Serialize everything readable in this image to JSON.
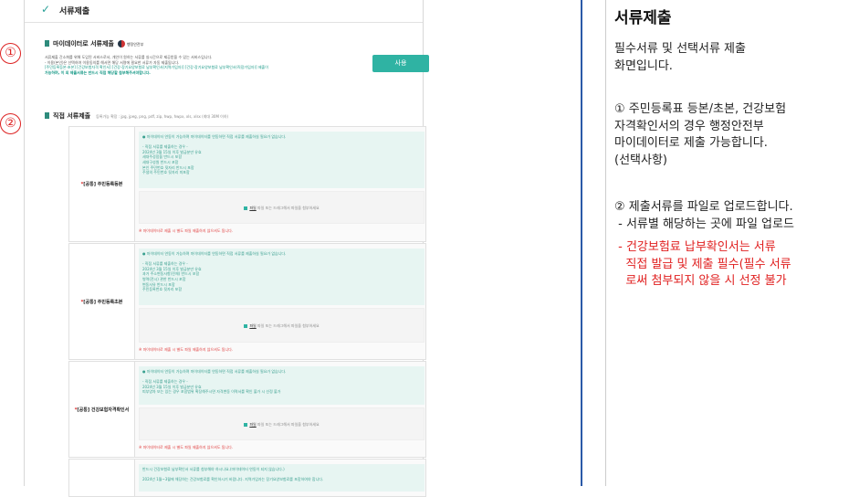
{
  "header": {
    "check_icon": "✓",
    "title": "서류제출"
  },
  "mydata": {
    "marker": "①",
    "title": "마이데이터로 서류제출",
    "gov_label": "행정안전부",
    "desc_lines": [
      "서류제출 간소화를 위해 도입된 서비스로서, 개인이 원하는 서류를 실시간으로 제공받을 수 있는 서비스입니다.",
      "- 이용(본인)은 선택하여 이용동의를 해서면 해당 서명에 필요한 서류가 자동 제출됩니다."
    ],
    "teal_line": "[주민등록등본·초본] [건강보험자격 확인서] [건강·장기요양보험료 납부확인서(지역가입자)] [건강·장기요양보험료 납부확인서(직장가입자)] 제출이",
    "note_line": "가능하며, 이 외 제출서류는 반드시 직접 해당할 첨부해주셔야합니다.",
    "button": "사용"
  },
  "direct": {
    "marker": "②",
    "title": "직접 서류제출",
    "hint": "등록가능 확장 : jpg, jpeg, png, pdf, zip, hwp, hwpx, xls, xlsx (최대 30M 이하)"
  },
  "docs": [
    {
      "req": "*",
      "label": "[공통] 주민등록등본",
      "info": [
        "● 마이데이터 연동이 가능하며 마이데이터를 연동하면 직접 서류를 제출하실 필요가 없습니다.",
        "",
        "- 직접 서류를 제출하는 경우 -",
        "2024년 3월 15일 이후 발급분만 유효",
        "세대주성함을 반드시 포함",
        "세대구성원 반드시 포함",
        "본인 주민번호 뒷자리 반드시 포함",
        "주생의 주민번호 뒷자리 미포함"
      ],
      "drop": "파일 또는 드래그해서 파일을 첨부하세요",
      "drop_link": "파일",
      "warn": "※ 마이데이터로 제출 시 별도 파일 제출하지 않으셔도 됩니다."
    },
    {
      "req": "*",
      "label": "[공통] 주민등록초본",
      "info": [
        "● 마이데이터 연동이 가능하며 마이데이터를 연동하면 직접 서류를 제출하실 필요가 없습니다.",
        "",
        "- 직접 서류를 제출하는 경우 -",
        "2024년 3월 15일 이후 발급분만 유효",
        "과거 주소변동사항(전체) 반드시 포함",
        "병역(전시) 관한 반드시 포함",
        "변동사유 반드시 포함",
        "주민등록번호 뒷자리 포함"
      ],
      "drop": "파일 또는 드래그해서 파일을 첨부하세요",
      "drop_link": "파일",
      "warn": "※ 마이데이터로 제출 시 별도 파일 제출하지 않으셔도 됩니다."
    },
    {
      "req": "*",
      "label": "[공통] 건강보험자격확인서",
      "info": [
        "● 마이데이터 연동이 가능하며 마이데이터를 연동하면 직접 서류를 제출하실 필요가 없습니다.",
        "",
        "- 직접 서류를 제출하는 경우 -",
        "2024년 3월 15일 이후 발급분만 유효",
        "피부양자 또는 있는 경우 포함범위 확장해주시면 자격변동 이력서를 확인 불가 시 선정 불가"
      ],
      "drop": "파일 또는 드래그해서 파일을 첨부하세요",
      "drop_link": "파일",
      "warn": "※ 마이데이터로 제출 시 별도 파일 제출하지 않으셔도 됩니다."
    },
    {
      "info": [
        "반드시 건강보험료 납부확인서 서류를 첨부해야 하시나요.(마이데이터 연동이 되지 않습니다.)",
        "",
        "2024년 1월~3월에 해당하는 건강보험료를 확인하시기 바랍니다. 지역가입자는 장기요양보험료를 포함하여야 합니다."
      ]
    }
  ],
  "panel": {
    "title": "서류제출",
    "intro": "필수서류 및 선택서류 제출\n화면입니다.",
    "item1": "① 주민등록표 등본/초본, 건강보험\n자격확인서의 경우 행정안전부\n마이데이터로 제출 가능합니다.\n(선택사항)",
    "item2": "② 제출서류를 파일로 업로드합니다.\n - 서류별 해당하는 곳에 파일 업로드",
    "item2_red": " - 건강보험료 납부확인서는 서류\n   직접 발급 및 제출 필수(필수 서류\n   로써 첨부되지 않을 시 선정 불가"
  },
  "colors": {
    "accent": "#2fb3a3",
    "marker": "#d22222",
    "warning": "#e02020",
    "divider": "#2b5aa8"
  }
}
